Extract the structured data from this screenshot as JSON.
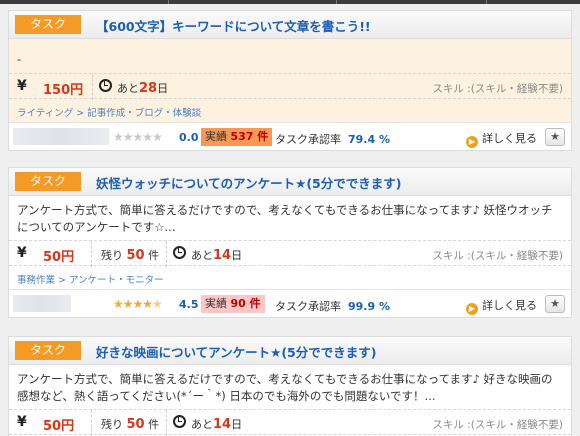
{
  "cards": [
    {
      "badge": "タスク",
      "title": "【600文字】キーワードについて文章を書こう!!",
      "description": "-",
      "yen_symbol": "¥",
      "price": "150円",
      "deadline_prefix": "あと",
      "deadline_value": "28",
      "deadline_unit": "日",
      "skill": "スキル :(スキル・経験不要)",
      "categories": [
        "ライティング",
        "記事作成・ブログ・体験談"
      ],
      "stars": 0,
      "rating": "0.0",
      "jisseki_label": "実績",
      "jisseki_value": "537 件",
      "approval_label": "タスク承認率",
      "approval_value": "79.4 %",
      "detail_label": "詳しく見る",
      "fav_icon": "★"
    },
    {
      "badge": "タスク",
      "title": "妖怪ウォッチについてのアンケート★(5分でできます)",
      "description": "アンケート方式で、簡単に答えるだけですので、考えなくてもできるお仕事になってます♪ 妖怪ウオッチについてのアンケートです☆...",
      "yen_symbol": "¥",
      "price": "50円",
      "remain_prefix": "残り",
      "remain_value": "50",
      "remain_unit": "件",
      "deadline_prefix": "あと",
      "deadline_value": "14",
      "deadline_unit": "日",
      "skill": "スキル :(スキル・経験不要)",
      "categories": [
        "事務作業",
        "アンケート・モニター"
      ],
      "stars": 4.5,
      "rating": "4.5",
      "jisseki_label": "実績",
      "jisseki_value": "90 件",
      "approval_label": "タスク承認率",
      "approval_value": "99.9 %",
      "detail_label": "詳しく見る",
      "fav_icon": "★"
    },
    {
      "badge": "タスク",
      "title": "好きな映画についてアンケート★(5分でできます)",
      "description": "アンケート方式で、簡単に答えるだけですので、考えなくてもできるお仕事になってます♪ 好きな映画の感想など、熱く語ってください(*´ー｀*) 日本のでも海外のでも問題ないです！...",
      "yen_symbol": "¥",
      "price": "50円",
      "remain_prefix": "残り",
      "remain_value": "50",
      "remain_unit": "件",
      "deadline_prefix": "あと",
      "deadline_value": "14",
      "deadline_unit": "日",
      "skill": "スキル :(スキル・経験不要)"
    }
  ],
  "category_separator": ">"
}
